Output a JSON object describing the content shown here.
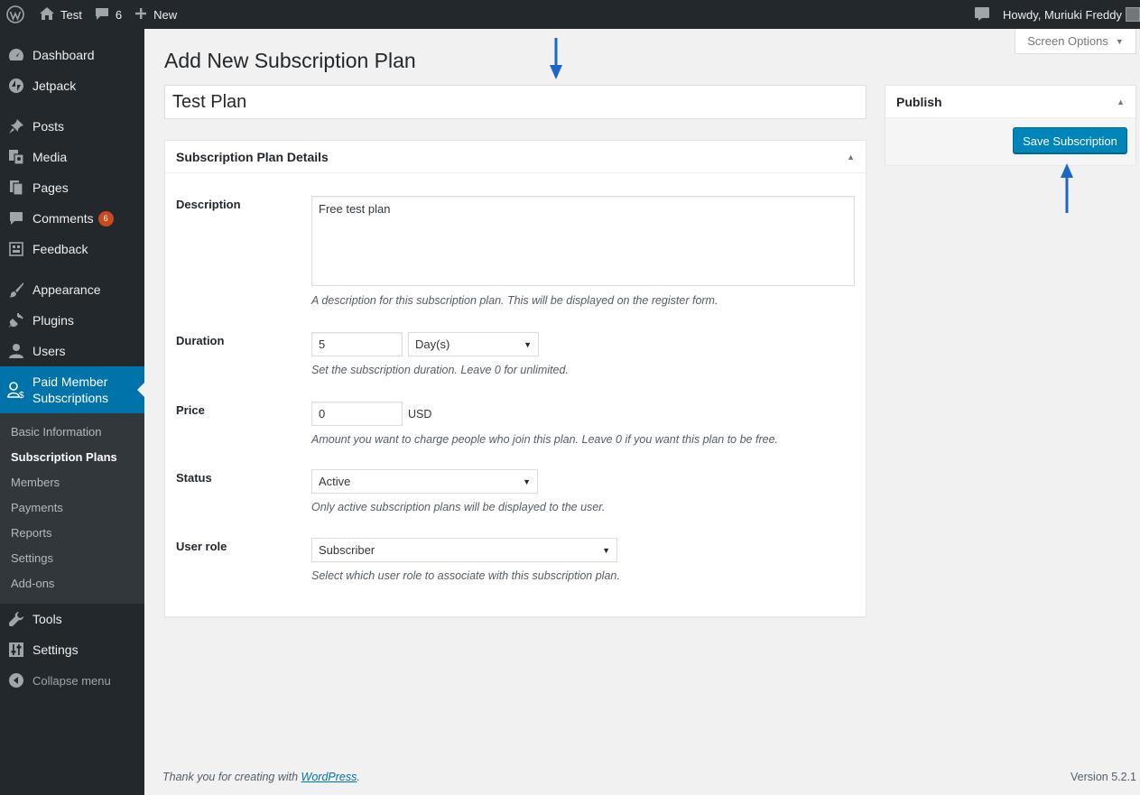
{
  "admin_bar": {
    "site_name": "Test",
    "comments_count": "6",
    "new_label": "New",
    "greeting": "Howdy, Muriuki Freddy"
  },
  "sidebar": {
    "items": [
      {
        "label": "Dashboard",
        "icon": "dashboard-icon"
      },
      {
        "label": "Jetpack",
        "icon": "jetpack-icon"
      },
      {
        "label": "Posts",
        "icon": "pin-icon"
      },
      {
        "label": "Media",
        "icon": "media-icon"
      },
      {
        "label": "Pages",
        "icon": "pages-icon"
      },
      {
        "label": "Comments",
        "icon": "comment-icon",
        "badge": "6"
      },
      {
        "label": "Feedback",
        "icon": "feedback-icon"
      },
      {
        "label": "Appearance",
        "icon": "brush-icon"
      },
      {
        "label": "Plugins",
        "icon": "plug-icon"
      },
      {
        "label": "Users",
        "icon": "user-icon"
      },
      {
        "label": "Paid Member Subscriptions",
        "icon": "member-dollar-icon"
      },
      {
        "label": "Tools",
        "icon": "wrench-icon"
      },
      {
        "label": "Settings",
        "icon": "sliders-icon"
      },
      {
        "label": "Collapse menu",
        "icon": "collapse-icon"
      }
    ],
    "submenu": [
      "Basic Information",
      "Subscription Plans",
      "Members",
      "Payments",
      "Reports",
      "Settings",
      "Add-ons"
    ],
    "active_submenu": "Subscription Plans"
  },
  "screen_options_label": "Screen Options",
  "page_title": "Add New Subscription Plan",
  "title_value": "Test Plan",
  "details": {
    "heading": "Subscription Plan Details",
    "description": {
      "label": "Description",
      "value": "Free test plan",
      "help": "A description for this subscription plan. This will be displayed on the register form."
    },
    "duration": {
      "label": "Duration",
      "value": "5",
      "unit": "Day(s)",
      "help": "Set the subscription duration. Leave 0 for unlimited."
    },
    "price": {
      "label": "Price",
      "value": "0",
      "currency": "USD",
      "help": "Amount you want to charge people who join this plan. Leave 0 if you want this plan to be free."
    },
    "status": {
      "label": "Status",
      "value": "Active",
      "help": "Only active subscription plans will be displayed to the user."
    },
    "user_role": {
      "label": "User role",
      "value": "Subscriber",
      "help": "Select which user role to associate with this subscription plan."
    }
  },
  "publish": {
    "heading": "Publish",
    "save_label": "Save Subscription"
  },
  "footer": {
    "thanks_prefix": "Thank you for creating with ",
    "thanks_link": "WordPress",
    "thanks_suffix": ".",
    "version": "Version 5.2.1"
  },
  "colors": {
    "admin_dark": "#23282d",
    "accent": "#0073aa",
    "button": "#0085ba",
    "badge": "#ca4a1f",
    "annotation_arrow": "#1a66c9"
  }
}
